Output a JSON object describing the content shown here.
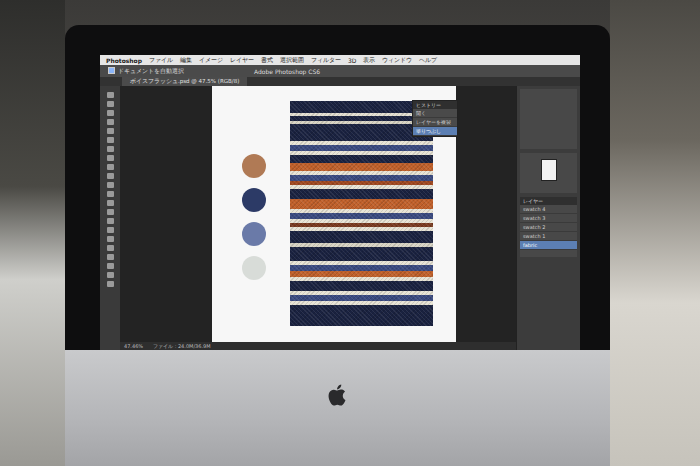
{
  "menubar": {
    "app": "Photoshop",
    "items": [
      "ファイル",
      "編集",
      "イメージ",
      "レイヤー",
      "書式",
      "選択範囲",
      "フィルター",
      "3D",
      "表示",
      "ウィンドウ",
      "ヘルプ"
    ]
  },
  "window": {
    "title": "Adobe Photoshop CS6"
  },
  "options_bar": {
    "checkbox_label": "ドキュメントを自動選択",
    "checked": true
  },
  "document_tab": {
    "label": "ボイスフラッシュ.psd @ 47.5% (RGB/8)"
  },
  "swatches": [
    {
      "color": "#b07a55"
    },
    {
      "color": "#2c3a66"
    },
    {
      "color": "#6a7aa8"
    },
    {
      "color": "#d8dcd8"
    }
  ],
  "history_panel": {
    "title": "ヒストリー",
    "items": [
      {
        "label": "開く",
        "selected": false
      },
      {
        "label": "レイヤーを複製",
        "selected": false
      },
      {
        "label": "塗りつぶし",
        "selected": true
      }
    ]
  },
  "layers_panel": {
    "title": "レイヤー",
    "items": [
      {
        "label": "swatch 4",
        "selected": false
      },
      {
        "label": "swatch 3",
        "selected": false
      },
      {
        "label": "swatch 2",
        "selected": false
      },
      {
        "label": "swatch 1",
        "selected": false
      },
      {
        "label": "fabric",
        "selected": true
      }
    ]
  },
  "status_bar": {
    "zoom": "47.46%",
    "info": "ファイル : 24.0M/36.9M"
  }
}
